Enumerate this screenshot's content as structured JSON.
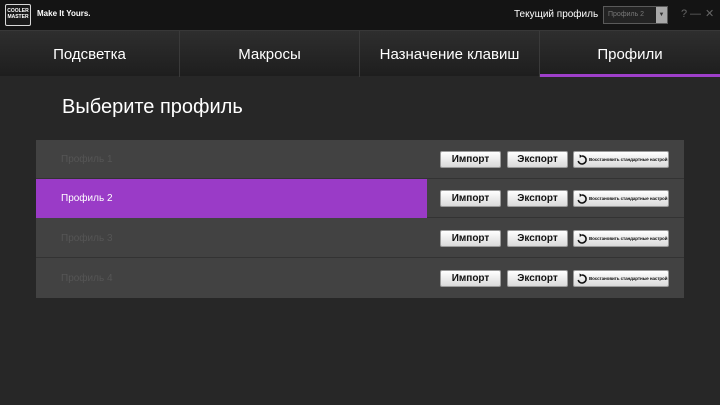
{
  "titlebar": {
    "logo_text": "COOLER MASTER",
    "slogan": "Make It Yours.",
    "current_profile_label": "Текущий профиль",
    "current_profile_value": "Профиль 2",
    "help": "?",
    "minimize": "—",
    "close": "✕"
  },
  "nav": {
    "tabs": [
      {
        "label": "Подсветка",
        "active": false
      },
      {
        "label": "Макросы",
        "active": false
      },
      {
        "label": "Назначение клавиш",
        "active": false
      },
      {
        "label": "Профили",
        "active": true
      }
    ]
  },
  "page": {
    "title": "Выберите профиль"
  },
  "profiles": [
    {
      "name": "Профиль 1",
      "selected": false,
      "import_label": "Импорт",
      "export_label": "Экспорт",
      "restore_label": "Восстановить стандартные настрой"
    },
    {
      "name": "Профиль 2",
      "selected": true,
      "import_label": "Импорт",
      "export_label": "Экспорт",
      "restore_label": "Восстановить стандартные настрой"
    },
    {
      "name": "Профиль 3",
      "selected": false,
      "import_label": "Импорт",
      "export_label": "Экспорт",
      "restore_label": "Восстановить стандартные настрой"
    },
    {
      "name": "Профиль 4",
      "selected": false,
      "import_label": "Импорт",
      "export_label": "Экспорт",
      "restore_label": "Восстановить стандартные настрой"
    }
  ],
  "colors": {
    "accent": "#9a3bc7",
    "background": "#272727",
    "list_background": "#424242"
  }
}
